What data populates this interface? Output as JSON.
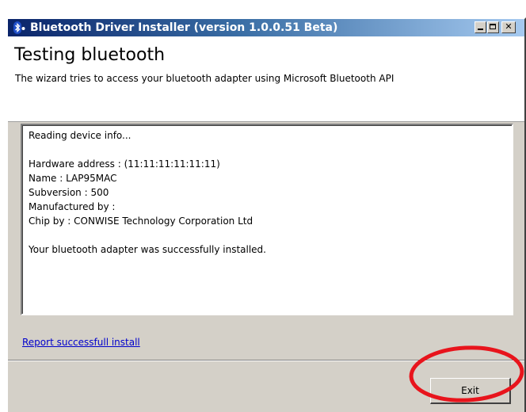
{
  "window": {
    "title": "Bluetooth Driver Installer (version 1.0.0.51 Beta)",
    "icon": "bluetooth-icon",
    "controls": [
      "minimize-icon",
      "maximize-icon",
      "close-icon"
    ]
  },
  "header": {
    "heading": "Testing bluetooth",
    "subheading": "The wizard tries to access your bluetooth adapter using Microsoft Bluetooth API"
  },
  "log": {
    "lines": [
      "Reading device info...",
      "",
      "Hardware address : (11:11:11:11:11:11)",
      "Name : LAP95MAC",
      "Subversion : 500",
      "Manufactured by :",
      "Chip by : CONWISE Technology Corporation Ltd",
      "",
      "Your bluetooth adapter was successfully installed."
    ]
  },
  "footer": {
    "report_link": "Report successfull install",
    "exit_label": "Exit"
  },
  "colors": {
    "annotation_circle": "#e8141c",
    "link": "#0000cc",
    "title_gradient_start": "#0a246a",
    "title_gradient_end": "#a6caf0"
  }
}
